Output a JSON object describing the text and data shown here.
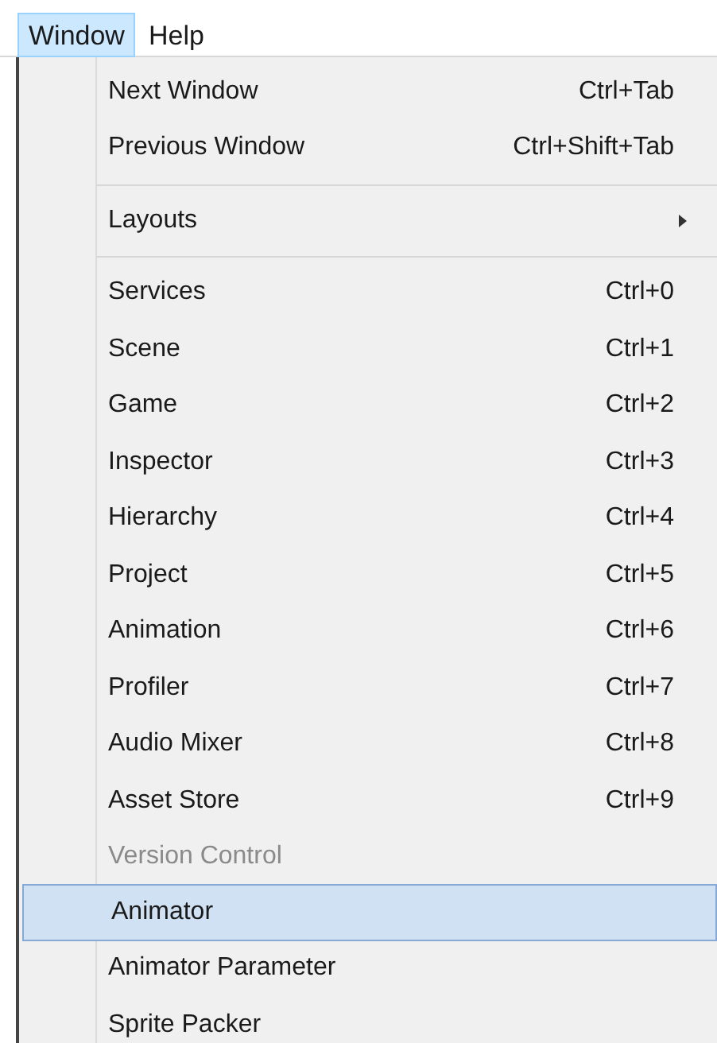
{
  "menu_bar": [
    {
      "label": "Window",
      "selected": true
    },
    {
      "label": "Help",
      "selected": false
    }
  ],
  "menu": [
    {
      "kind": "item",
      "label": "Next Window",
      "shortcut": "Ctrl+Tab",
      "selected": false,
      "disabled": false
    },
    {
      "kind": "item",
      "label": "Previous Window",
      "shortcut": "Ctrl+Shift+Tab",
      "selected": false,
      "disabled": false
    },
    {
      "kind": "separator"
    },
    {
      "kind": "submenu",
      "label": "Layouts",
      "selected": false,
      "disabled": false
    },
    {
      "kind": "separator"
    },
    {
      "kind": "item",
      "label": "Services",
      "shortcut": "Ctrl+0",
      "selected": false,
      "disabled": false
    },
    {
      "kind": "item",
      "label": "Scene",
      "shortcut": "Ctrl+1",
      "selected": false,
      "disabled": false
    },
    {
      "kind": "item",
      "label": "Game",
      "shortcut": "Ctrl+2",
      "selected": false,
      "disabled": false
    },
    {
      "kind": "item",
      "label": "Inspector",
      "shortcut": "Ctrl+3",
      "selected": false,
      "disabled": false
    },
    {
      "kind": "item",
      "label": "Hierarchy",
      "shortcut": "Ctrl+4",
      "selected": false,
      "disabled": false
    },
    {
      "kind": "item",
      "label": "Project",
      "shortcut": "Ctrl+5",
      "selected": false,
      "disabled": false
    },
    {
      "kind": "item",
      "label": "Animation",
      "shortcut": "Ctrl+6",
      "selected": false,
      "disabled": false
    },
    {
      "kind": "item",
      "label": "Profiler",
      "shortcut": "Ctrl+7",
      "selected": false,
      "disabled": false
    },
    {
      "kind": "item",
      "label": "Audio Mixer",
      "shortcut": "Ctrl+8",
      "selected": false,
      "disabled": false
    },
    {
      "kind": "item",
      "label": "Asset Store",
      "shortcut": "Ctrl+9",
      "selected": false,
      "disabled": false
    },
    {
      "kind": "item",
      "label": "Version Control",
      "selected": false,
      "disabled": true
    },
    {
      "kind": "item",
      "label": "Animator",
      "selected": true,
      "disabled": false
    },
    {
      "kind": "item",
      "label": "Animator Parameter",
      "selected": false,
      "disabled": false
    },
    {
      "kind": "item",
      "label": "Sprite Packer",
      "selected": false,
      "disabled": false
    }
  ]
}
